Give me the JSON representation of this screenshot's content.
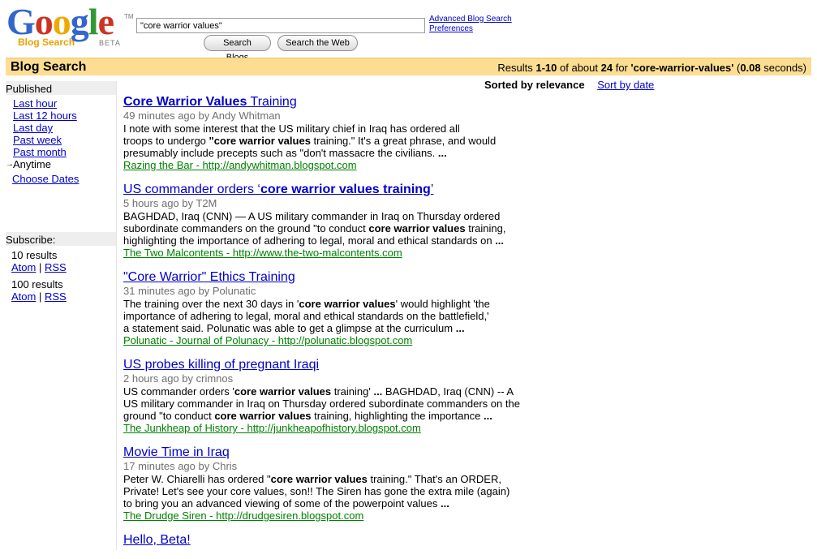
{
  "header": {
    "logo_text": "Google",
    "logo_sub": "Blog Search",
    "logo_beta": "BETA",
    "logo_tm": "TM",
    "search_value": "\"core warrior values\"",
    "btn_search_blogs": "Search Blogs",
    "btn_search_web": "Search the Web",
    "link_advanced": "Advanced Blog Search",
    "link_preferences": "Preferences"
  },
  "bar": {
    "title": "Blog Search",
    "stats_prefix": "Results ",
    "stats_range": "1-10",
    "stats_mid": " of about ",
    "stats_count": "24",
    "stats_for": " for ",
    "stats_query": "'core-warrior-values'",
    "stats_open": " (",
    "stats_time": "0.08",
    "stats_close": " seconds)"
  },
  "sidebar": {
    "published_label": "Published",
    "items": [
      "Last hour",
      "Last 12 hours",
      "Last day",
      "Past week",
      "Past month",
      "Anytime"
    ],
    "arrow": "→",
    "choose_dates": "Choose Dates",
    "subscribe_label": "Subscribe:",
    "ten_results": "10 results",
    "hundred_results": "100 results",
    "atom": "Atom",
    "sep": "|",
    "rss": "RSS"
  },
  "sort": {
    "current": "Sorted by relevance",
    "alternate": "Sort by date"
  },
  "results": [
    {
      "title": "Core Warrior Values Training",
      "meta": "49 minutes ago by Andy Whitman",
      "source": "Razing the Bar - http://andywhitman.blogspot.com"
    },
    {
      "title": "US commander orders ‘core warrior values training’",
      "meta": "5 hours ago by T2M",
      "source": "The Two Malcontents - http://www.the-two-malcontents.com"
    },
    {
      "title": "\"Core Warrior\" Ethics Training",
      "meta": "31 minutes ago by Polunatic",
      "source": "Polunatic - Journal of Polunacy - http://polunatic.blogspot.com"
    },
    {
      "title": "US probes killing of pregnant Iraqi",
      "meta": "2 hours ago by crimnos",
      "source": "The Junkheap of History - http://junkheapofhistory.blogspot.com"
    },
    {
      "title": "Movie Time in Iraq",
      "meta": "17 minutes ago by Chris",
      "source": "The Drudge Siren - http://drudgesiren.blogspot.com"
    },
    {
      "title": "Hello, Beta!"
    }
  ],
  "snippets": {
    "r0": [
      "I note with some interest that the US military chief in Iraq has ordered all",
      "troops to undergo ",
      "\"core warrior values",
      " training.\" It's a great phrase, and would",
      "presumably include precepts such as \"don't massacre the civilians. ",
      "..."
    ],
    "r1": [
      "BAGHDAD, Iraq (CNN) — A US military commander in Iraq on Thursday ordered",
      "subordinate commanders on the ground \"to conduct ",
      "core warrior values",
      " training,",
      "highlighting the importance of adhering to legal, moral and ethical standards on ",
      "..."
    ],
    "r2": [
      "The training over the next 30 days in '",
      "core warrior values",
      "' would highlight 'the",
      "importance of adhering to legal, moral and ethical standards on the battlefield,'",
      "a statement said. Polunatic was able to get a glimpse at the curriculum ",
      "..."
    ],
    "r3": [
      "US commander orders '",
      "core warrior values",
      " training' ",
      "...",
      " BAGHDAD, Iraq (CNN) -- A",
      "US military commander in Iraq on Thursday ordered subordinate commanders on the",
      "ground \"to conduct ",
      "core warrior values",
      " training, highlighting the importance ",
      "..."
    ],
    "r4": [
      "Peter W. Chiarelli has ordered \"",
      "core warrior values",
      " training.\" That's an ORDER,",
      "Private! Let's see your core values, son!! The Siren has gone the extra mile (again)",
      "to bring you an advanced viewing of some of the powerpoint values ",
      "..."
    ]
  },
  "colors": {
    "bar_bg": "#fcdd92",
    "link": "#0000cc",
    "source_green": "#008000",
    "meta_gray": "#6f6f6f",
    "logo_blue": "#3366cc",
    "logo_red": "#cc3322",
    "logo_yellow": "#eeaa00",
    "logo_green": "#339933"
  }
}
